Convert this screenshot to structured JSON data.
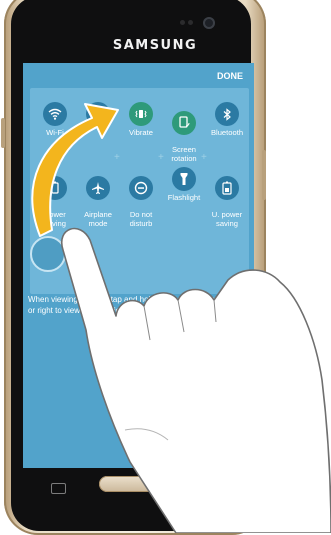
{
  "device": {
    "brand": "SAMSUNG"
  },
  "notification_panel": {
    "done_label": "DONE",
    "tiles_row1": [
      {
        "label": "Wi-Fi",
        "icon": "wifi-icon"
      },
      {
        "label": "",
        "icon": "location-icon"
      },
      {
        "label": "Vibrate",
        "icon": "vibrate-icon",
        "active": true
      },
      {
        "label": "Screen\nrotation",
        "icon": "screen-rotation-icon",
        "active": true
      },
      {
        "label": "Bluetooth",
        "icon": "bluetooth-icon"
      }
    ],
    "tiles_row2": [
      {
        "label": "Power\nsaving",
        "icon": "power-saving-icon"
      },
      {
        "label": "Airplane\nmode",
        "icon": "airplane-icon"
      },
      {
        "label": "Do not\ndisturb",
        "icon": "do-not-disturb-icon"
      },
      {
        "label": "Flashlight",
        "icon": "flashlight-icon"
      },
      {
        "label": "U. power\nsaving",
        "icon": "ultra-power-saving-icon"
      }
    ],
    "instruction_text": "When viewing buttons, tap and hold a button and drag it left or right to view more options."
  },
  "overlay": {
    "arrow_color": "#f3b51d",
    "hand": "pointing-hand"
  },
  "colors": {
    "screen_bg": "#52a3cb",
    "panel_bg": "#6fb6d9",
    "accent": "#2e9a7a"
  }
}
